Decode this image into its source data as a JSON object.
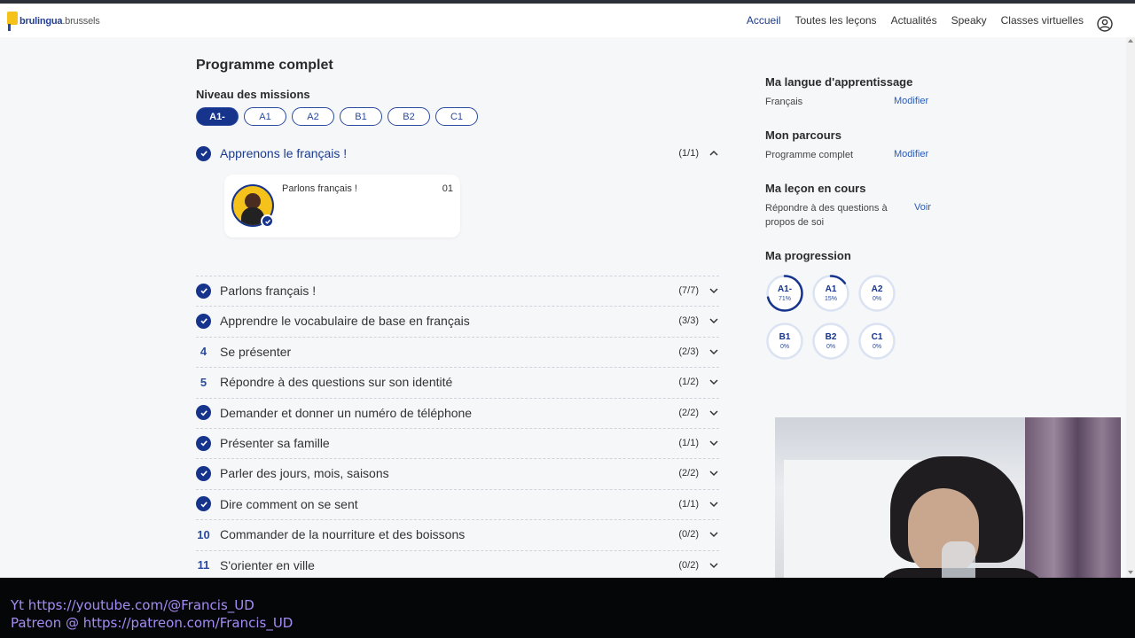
{
  "header": {
    "logo_main": "brulingua",
    "logo_suffix": ".brussels",
    "nav": [
      {
        "label": "Accueil",
        "active": true
      },
      {
        "label": "Toutes les leçons",
        "active": false
      },
      {
        "label": "Actualités",
        "active": false
      },
      {
        "label": "Speaky",
        "active": false
      },
      {
        "label": "Classes virtuelles",
        "active": false
      }
    ],
    "user_icon": "user-circle-icon"
  },
  "main": {
    "title": "Programme complet",
    "levels_title": "Niveau des missions",
    "levels": [
      {
        "label": "A1-",
        "active": true
      },
      {
        "label": "A1",
        "active": false
      },
      {
        "label": "A2",
        "active": false
      },
      {
        "label": "B1",
        "active": false
      },
      {
        "label": "B2",
        "active": false
      },
      {
        "label": "C1",
        "active": false
      }
    ],
    "expanded_mission": {
      "title": "Apprenons le français !",
      "count": "(1/1)",
      "completed": true,
      "lesson": {
        "title": "Parlons français !",
        "number": "01",
        "completed": true
      }
    },
    "missions": [
      {
        "title": "Parlons français !",
        "count": "(7/7)",
        "completed": true,
        "number": ""
      },
      {
        "title": "Apprendre le vocabulaire de base en français",
        "count": "(3/3)",
        "completed": true,
        "number": ""
      },
      {
        "title": "Se présenter",
        "count": "(2/3)",
        "completed": false,
        "number": "4"
      },
      {
        "title": "Répondre à des questions sur son identité",
        "count": "(1/2)",
        "completed": false,
        "number": "5"
      },
      {
        "title": "Demander et donner un numéro de téléphone",
        "count": "(2/2)",
        "completed": true,
        "number": ""
      },
      {
        "title": "Présenter sa famille",
        "count": "(1/1)",
        "completed": true,
        "number": ""
      },
      {
        "title": "Parler des jours, mois, saisons",
        "count": "(2/2)",
        "completed": true,
        "number": ""
      },
      {
        "title": "Dire comment on se sent",
        "count": "(1/1)",
        "completed": true,
        "number": ""
      },
      {
        "title": "Commander de la nourriture et des boissons",
        "count": "(0/2)",
        "completed": false,
        "number": "10"
      },
      {
        "title": "S'orienter en ville",
        "count": "(0/2)",
        "completed": false,
        "number": "11"
      }
    ]
  },
  "sidebar": {
    "language_title": "Ma langue d'apprentissage",
    "language_value": "Français",
    "language_action": "Modifier",
    "path_title": "Mon parcours",
    "path_value": "Programme complet",
    "path_action": "Modifier",
    "current_title": "Ma leçon en cours",
    "current_value": "Répondre à des questions à propos de soi",
    "current_action": "Voir",
    "progress_title": "Ma progression",
    "progress": [
      {
        "level": "A1-",
        "percent_label": "71%",
        "percent": 71
      },
      {
        "level": "A1",
        "percent_label": "15%",
        "percent": 15
      },
      {
        "level": "A2",
        "percent_label": "0%",
        "percent": 0
      },
      {
        "level": "B1",
        "percent_label": "0%",
        "percent": 0
      },
      {
        "level": "B2",
        "percent_label": "0%",
        "percent": 0
      },
      {
        "level": "C1",
        "percent_label": "0%",
        "percent": 0
      }
    ]
  },
  "overlay": {
    "line1": "Yt https://youtube.com/@Francis_UD",
    "line2": "Patreon @ https://patreon.com/Francis_UD"
  },
  "colors": {
    "primary": "#16348c",
    "accent": "#f4c21b",
    "link": "#2a5ab8",
    "overlay_text": "#a58cf4"
  }
}
